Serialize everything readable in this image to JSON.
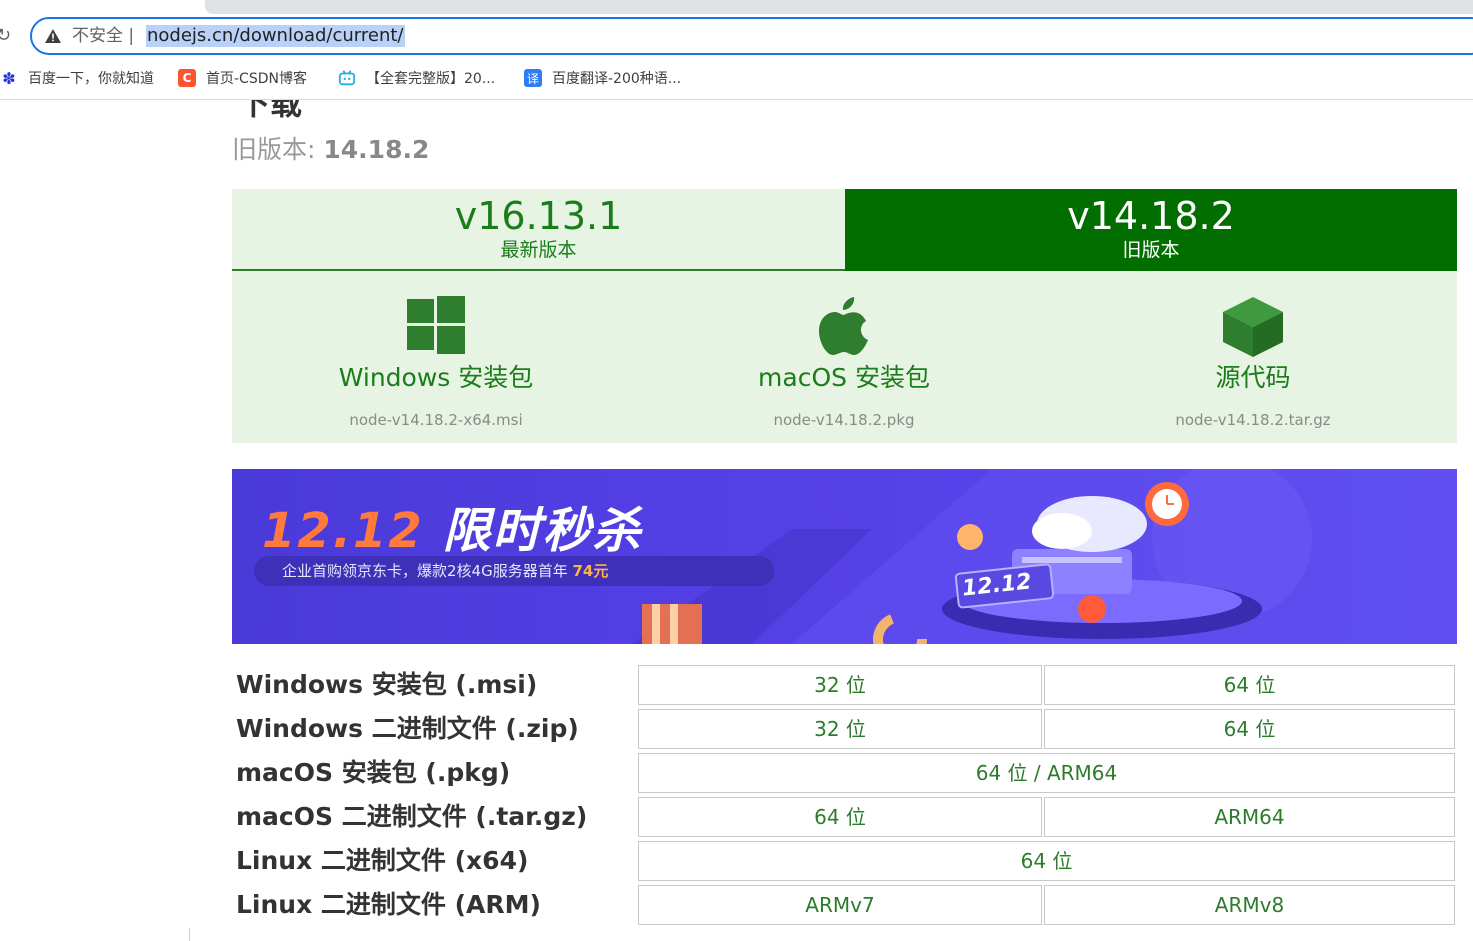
{
  "browser": {
    "security_label": "不安全",
    "url": "nodejs.cn/download/current/",
    "bookmarks": [
      {
        "label": "百度一下，你就知道",
        "icon": "baidu-paw-icon"
      },
      {
        "label": "首页-CSDN博客",
        "icon": "csdn-icon"
      },
      {
        "label": "【全套完整版】20...",
        "icon": "bilibili-tv-icon"
      },
      {
        "label": "百度翻译-200种语...",
        "icon": "baidu-translate-icon"
      }
    ]
  },
  "page": {
    "heading_partial": "下载",
    "old_version_label": "旧版本:",
    "old_version_value": "14.18.2",
    "version_tabs": [
      {
        "version": "v16.13.1",
        "caption": "最新版本",
        "active": false
      },
      {
        "version": "v14.18.2",
        "caption": "旧版本",
        "active": true
      }
    ],
    "downloads": [
      {
        "label": "Windows 安装包",
        "file": "node-v14.18.2-x64.msi",
        "icon": "windows-logo-icon"
      },
      {
        "label": "macOS 安装包",
        "file": "node-v14.18.2.pkg",
        "icon": "apple-logo-icon"
      },
      {
        "label": "源代码",
        "file": "node-v14.18.2.tar.gz",
        "icon": "source-cube-icon"
      }
    ],
    "banner": {
      "title_part1": "12.12",
      "title_part2": "限时秒杀",
      "subtitle": "企业首购领京东卡，爆款2核4G服务器首年",
      "price": "74元",
      "badge": "12.12"
    },
    "table": [
      {
        "label": "Windows 安装包 (.msi)",
        "cells": [
          "32 位",
          "64 位"
        ]
      },
      {
        "label": "Windows 二进制文件 (.zip)",
        "cells": [
          "32 位",
          "64 位"
        ]
      },
      {
        "label": "macOS 安装包 (.pkg)",
        "cells": [
          "64 位 / ARM64"
        ]
      },
      {
        "label": "macOS 二进制文件 (.tar.gz)",
        "cells": [
          "64 位",
          "ARM64"
        ]
      },
      {
        "label": "Linux 二进制文件 (x64)",
        "cells": [
          "64 位"
        ]
      },
      {
        "label": "Linux 二进制文件 (ARM)",
        "cells": [
          "ARMv7",
          "ARMv8"
        ]
      }
    ]
  },
  "colors": {
    "green_dark": "#026e00",
    "green_text": "#1a7d1a",
    "panel_bg": "#e7f3e3",
    "banner_bg": "#5540e6"
  }
}
